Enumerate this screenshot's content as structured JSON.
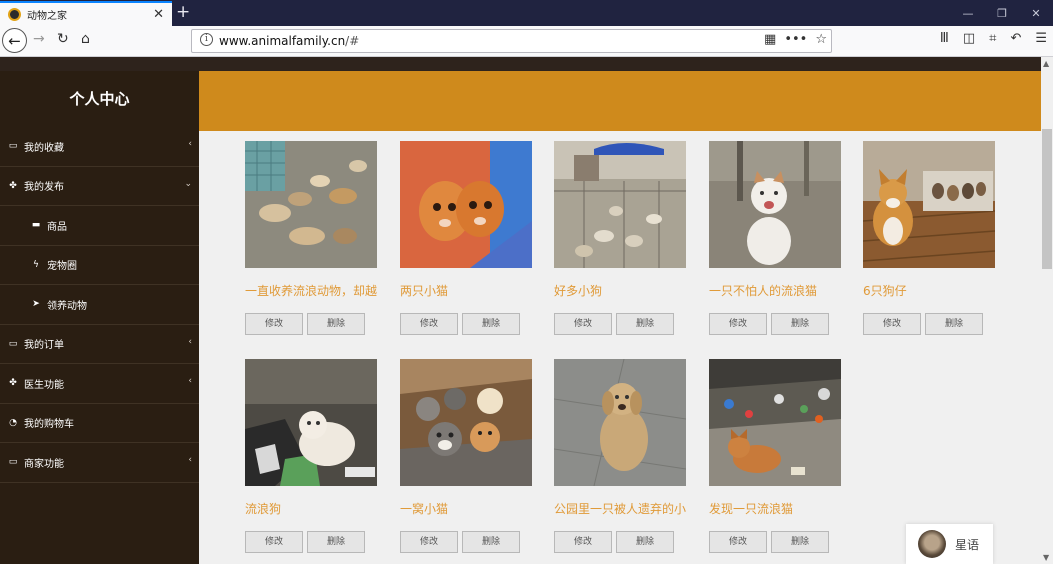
{
  "browser": {
    "tab_title": "动物之家",
    "url_host": "www.animalfamily.cn",
    "url_path": "/#",
    "icons": [
      "back-icon",
      "forward-icon",
      "reload-icon",
      "home-icon",
      "info-icon",
      "qr-icon",
      "more-icon",
      "bookmark-star-icon",
      "library-icon",
      "sidebar-icon",
      "crop-icon",
      "undo-icon",
      "menu-icon"
    ]
  },
  "sidebar": {
    "title": "个人中心",
    "items": [
      {
        "label": "我的收藏",
        "icon": "monitor-icon",
        "arrow": "‹"
      },
      {
        "label": "我的发布",
        "icon": "paw-icon",
        "arrow": "⌄"
      },
      {
        "label": "商品",
        "icon": "cup-icon",
        "arrow": ""
      },
      {
        "label": "宠物圈",
        "icon": "bolt-icon",
        "arrow": ""
      },
      {
        "label": "领养动物",
        "icon": "send-icon",
        "arrow": ""
      },
      {
        "label": "我的订单",
        "icon": "monitor-icon",
        "arrow": "‹"
      },
      {
        "label": "医生功能",
        "icon": "paw-icon",
        "arrow": "‹"
      },
      {
        "label": "我的购物车",
        "icon": "dashboard-icon",
        "arrow": ""
      },
      {
        "label": "商家功能",
        "icon": "monitor-icon",
        "arrow": "‹"
      }
    ]
  },
  "colors": {
    "sidebar_bg": "#2a1e12",
    "header_band": "#cf8a1c",
    "card_title": "#e09a38"
  },
  "posts": [
    {
      "title": "一直收养流浪动物，却越",
      "edit": "修改",
      "delete": "删除"
    },
    {
      "title": "两只小猫",
      "edit": "修改",
      "delete": "删除"
    },
    {
      "title": "好多小狗",
      "edit": "修改",
      "delete": "删除"
    },
    {
      "title": "一只不怕人的流浪猫",
      "edit": "修改",
      "delete": "删除"
    },
    {
      "title": "6只狗仔",
      "edit": "修改",
      "delete": "删除"
    },
    {
      "title": "流浪狗",
      "edit": "修改",
      "delete": "删除"
    },
    {
      "title": "一窝小猫",
      "edit": "修改",
      "delete": "删除"
    },
    {
      "title": "公园里一只被人遗弃的小",
      "edit": "修改",
      "delete": "删除"
    },
    {
      "title": "发现一只流浪猫",
      "edit": "修改",
      "delete": "删除"
    }
  ],
  "chat": {
    "label": "星语"
  }
}
